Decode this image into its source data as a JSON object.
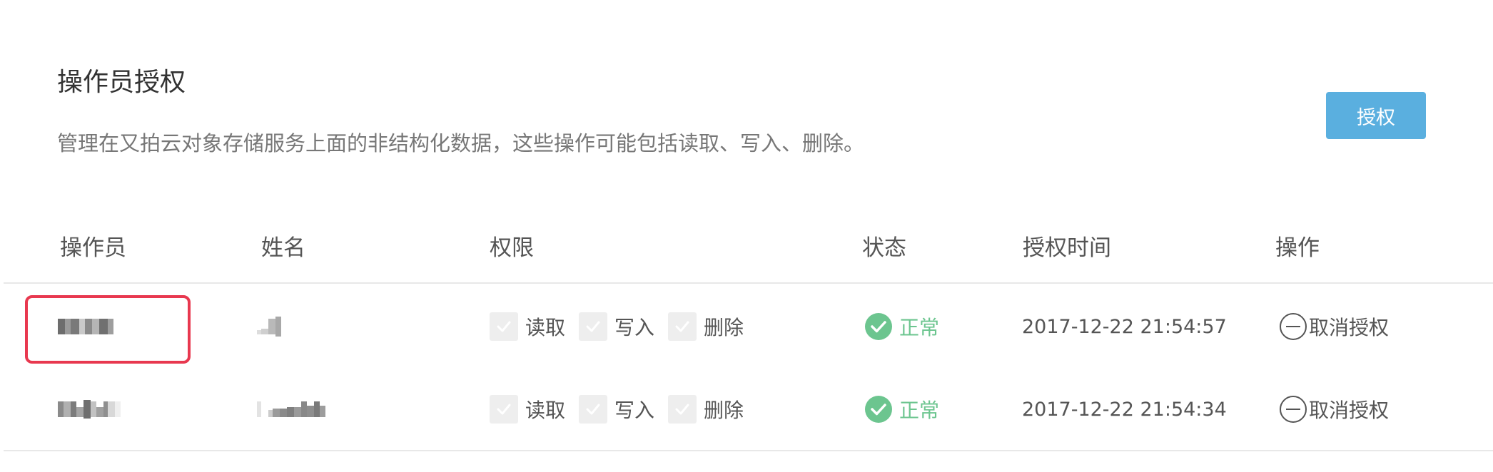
{
  "header": {
    "title": "操作员授权",
    "description": "管理在又拍云对象存储服务上面的非结构化数据，这些操作可能包括读取、写入、删除。",
    "authorize_button": "授权"
  },
  "table": {
    "columns": [
      "操作员",
      "姓名",
      "权限",
      "状态",
      "授权时间",
      "操作"
    ],
    "rows": [
      {
        "permissions": [
          "读取",
          "写入",
          "删除"
        ],
        "status": "正常",
        "time": "2017-12-22 21:54:57",
        "action": "取消授权"
      },
      {
        "permissions": [
          "读取",
          "写入",
          "删除"
        ],
        "status": "正常",
        "time": "2017-12-22 21:54:34",
        "action": "取消授权"
      }
    ]
  },
  "colors": {
    "primary_button": "#5aafdf",
    "status_ok": "#6cc58f",
    "highlight_border": "#e8384f"
  },
  "icons": {
    "checkbox": "check-icon",
    "status": "check-circle-icon",
    "action": "minus-circle-icon"
  }
}
